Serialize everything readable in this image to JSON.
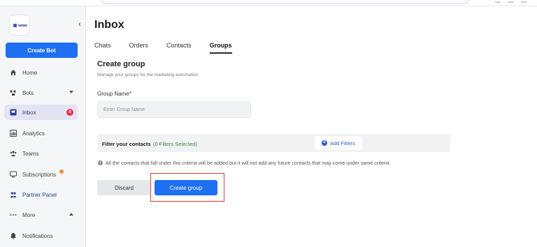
{
  "sidebar": {
    "create_bot_label": "Create Bot",
    "items": [
      {
        "label": "Home",
        "icon": "home-icon"
      },
      {
        "label": "Bots",
        "icon": "bots-icon"
      },
      {
        "label": "Inbox",
        "icon": "inbox-icon",
        "badge": "4"
      },
      {
        "label": "Analytics",
        "icon": "analytics-icon"
      },
      {
        "label": "Teams",
        "icon": "teams-icon"
      },
      {
        "label": "Subscriptions",
        "icon": "subscriptions-icon"
      },
      {
        "label": "Partner Panel",
        "icon": "partner-icon"
      },
      {
        "label": "More",
        "icon": "more-icon"
      },
      {
        "label": "Notifications",
        "icon": "bell-icon"
      }
    ]
  },
  "header": {
    "title": "Inbox",
    "tabs": [
      {
        "label": "Chats"
      },
      {
        "label": "Orders"
      },
      {
        "label": "Contacts"
      },
      {
        "label": "Groups"
      }
    ],
    "active_tab": "Groups"
  },
  "form": {
    "title": "Create group",
    "subtitle": "Manage your groups for the marketing automation",
    "group_name_label": "Group Name*",
    "group_name_placeholder": "Enter Group Name",
    "group_name_value": "",
    "filter_label": "Filter your contacts",
    "filter_count": "(0 Filters Selected)",
    "add_filters_label": "Add Filters",
    "info_text": "All the contacts that fall under this criteria will be added but it will not add any future contacts that may come under same criteria",
    "discard_label": "Discard",
    "create_label": "Create group"
  },
  "colors": {
    "primary": "#1e6ff1",
    "badge": "#e8344e",
    "highlight_box": "#e23b3b",
    "filter_count": "#3d8d3d",
    "active_nav_bg": "#e4e3f4"
  }
}
